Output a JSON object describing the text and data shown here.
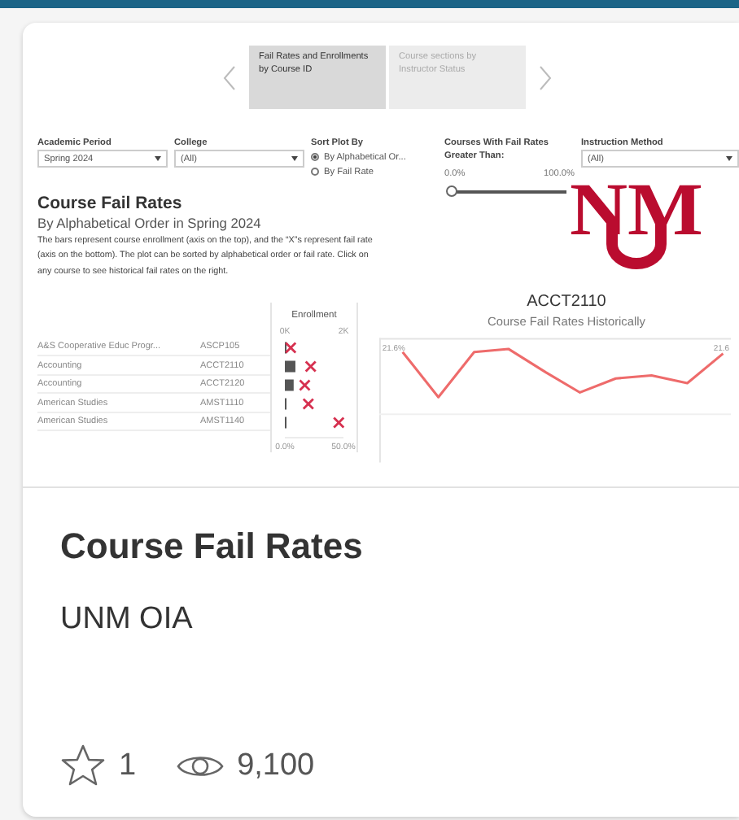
{
  "thumbnail": {
    "story_points": [
      {
        "label": "Fail Rates and Enrollments by Course ID",
        "selected": true
      },
      {
        "label": "Course sections by Instructor Status",
        "selected": false
      }
    ],
    "filters": [
      {
        "kind": "dropdown",
        "label": "Academic Period",
        "value": "Spring 2024"
      },
      {
        "kind": "dropdown",
        "label": "College",
        "value": "(All)"
      },
      {
        "kind": "radio",
        "label": "Sort Plot By",
        "options": [
          {
            "label": "By Alphabetical Or...",
            "selected": true
          },
          {
            "label": "By Fail Rate",
            "selected": false
          }
        ]
      }
    ],
    "right_filters": [
      {
        "kind": "slider",
        "label": "Courses With Fail Rates Greater Than:",
        "min_label": "0.0%",
        "max_label": "100.0%",
        "level": 0
      },
      {
        "kind": "dropdown",
        "label": "Instruction Method",
        "value": "(All)"
      }
    ],
    "logo": {
      "text": "NM"
    },
    "heading": "Course Fail Rates",
    "subheading": "By Alphabetical Order in Spring 2024",
    "description": "The bars represent course enrollment (axis on the top), and the “X”s represent fail rate (axis on the bottom). The plot can be sorted by alphabetical order or fail rate. Click on any course to see historical fail rates on the right.",
    "course_table": {
      "rows": [
        {
          "college": "A&S Cooperative Educ Progr..."
        },
        {
          "college": "Accounting"
        },
        {
          "college": "Accounting"
        },
        {
          "college": "American Studies"
        },
        {
          "college": "American Studies"
        }
      ],
      "enrollment": {
        "chart_data": {
          "type": "bar",
          "orientation": "horizontal",
          "title": "Enrollment",
          "categories": [
            "ASCP105",
            "ACCT2110",
            "ACCT2120",
            "AMST1110",
            "AMST1140"
          ],
          "series": [
            {
              "color": "#555555",
              "values": [
                10,
                360,
                300,
                40,
                40
              ]
            }
          ],
          "xlim": [
            0,
            2000
          ],
          "xticks": [
            {
              "value": 0,
              "label": "0K"
            },
            {
              "value": 2000,
              "label": "2K"
            }
          ]
        }
      },
      "fail_rate": {
        "chart_data": {
          "type": "scatter",
          "orientation": "horizontal",
          "categories": [
            null,
            null,
            null,
            null,
            null
          ],
          "series": [
            {
              "color": "#d6304f",
              "values": [
                0.05,
                0.22,
                0.17,
                0.2,
                0.46
              ]
            }
          ],
          "xlim": [
            0,
            0.5
          ],
          "xticks": [
            {
              "value": 0,
              "label": "0.0%"
            },
            {
              "value": 0.5,
              "label": "50.0%"
            }
          ]
        }
      }
    },
    "history": {
      "title": "ACCT2110",
      "subtitle": "Course Fail Rates Historically",
      "start_label": "21.6%",
      "end_label": "21.6"
    }
  },
  "title": "Course Fail Rates",
  "author": "UNM OIA",
  "favorites": "1",
  "views": "9,100"
}
